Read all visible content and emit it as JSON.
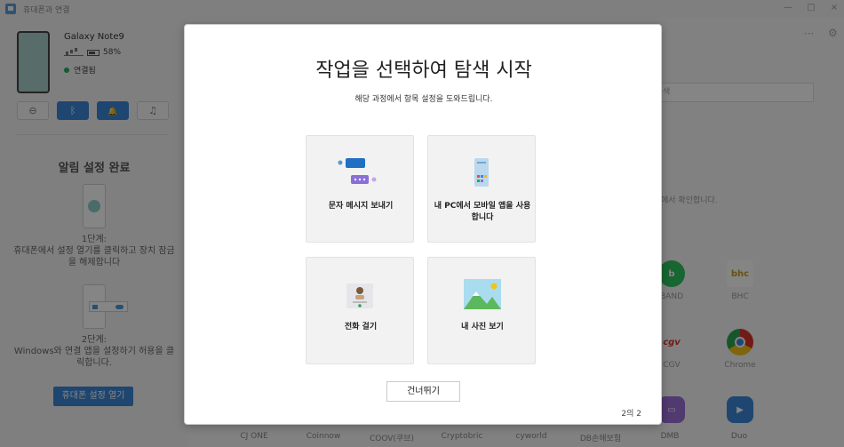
{
  "window": {
    "title": "휴대폰과 연결",
    "controls": {
      "minimize": "—",
      "maximize": "□",
      "close": "×"
    }
  },
  "sidebar": {
    "device_name": "Galaxy Note9",
    "battery": "58%",
    "status": "연결됨",
    "quick_buttons": [
      {
        "icon": "minus-circle-icon",
        "glyph": "⊖",
        "active": false
      },
      {
        "icon": "bluetooth-icon",
        "glyph": "ᛒ",
        "active": true
      },
      {
        "icon": "bell-icon",
        "glyph": "🔔",
        "active": true
      },
      {
        "icon": "music-note-icon",
        "glyph": "♫",
        "active": false
      }
    ],
    "notification_title": "알림 설정 완료",
    "step1_label": "1단계:",
    "step1_desc": "휴대폰에서 설정 열기를 클릭하고 장치 잠금을 해제합니다",
    "step2_label": "2단계:",
    "step2_desc": "Windows와 연결 앱을 설정하기 허용을 클릭합니다.",
    "open_settings_button": "휴대폰 설정 열기"
  },
  "main": {
    "more_icon": "···",
    "settings_icon": "⚙",
    "search_placeholder": "색",
    "hint_text": "에서 확인합니다.",
    "apps": [
      {
        "label": "BAND",
        "icon_text": "b",
        "color": "#2fc35f"
      },
      {
        "label": "BHC",
        "icon_text": "bhc",
        "color": "#e8c14a"
      },
      {
        "label": "CGV",
        "icon_text": "cgv",
        "color": "#d9342b"
      },
      {
        "label": "Chrome",
        "icon_text": "◉",
        "color": "#e8b43a"
      },
      {
        "label": "DMB",
        "icon_text": "▭",
        "color": "#9b6fd6"
      },
      {
        "label": "Duo",
        "icon_text": "▶",
        "color": "#3a86d6"
      }
    ],
    "bottom_labels": [
      "CJ ONE",
      "Coinnow",
      "COOV(쿠브)",
      "Cryptobric",
      "cyworld",
      "DB손해보험",
      "DMB",
      "Duo"
    ]
  },
  "dialog": {
    "title": "작업을 선택하여 탐색 시작",
    "subtitle": "해당 과정에서 항목 설정을 도와드립니다.",
    "cards": [
      {
        "label": "문자 메시지 보내기"
      },
      {
        "label": "내 PC에서 모바일 앱을 사용합니다"
      },
      {
        "label": "전화 걸기"
      },
      {
        "label": "내 사진 보기"
      }
    ],
    "skip_button": "건너뛰기",
    "page_indicator": "2의 2"
  },
  "colors": {
    "accent": "#3a86d6",
    "connected": "#27ae60"
  }
}
